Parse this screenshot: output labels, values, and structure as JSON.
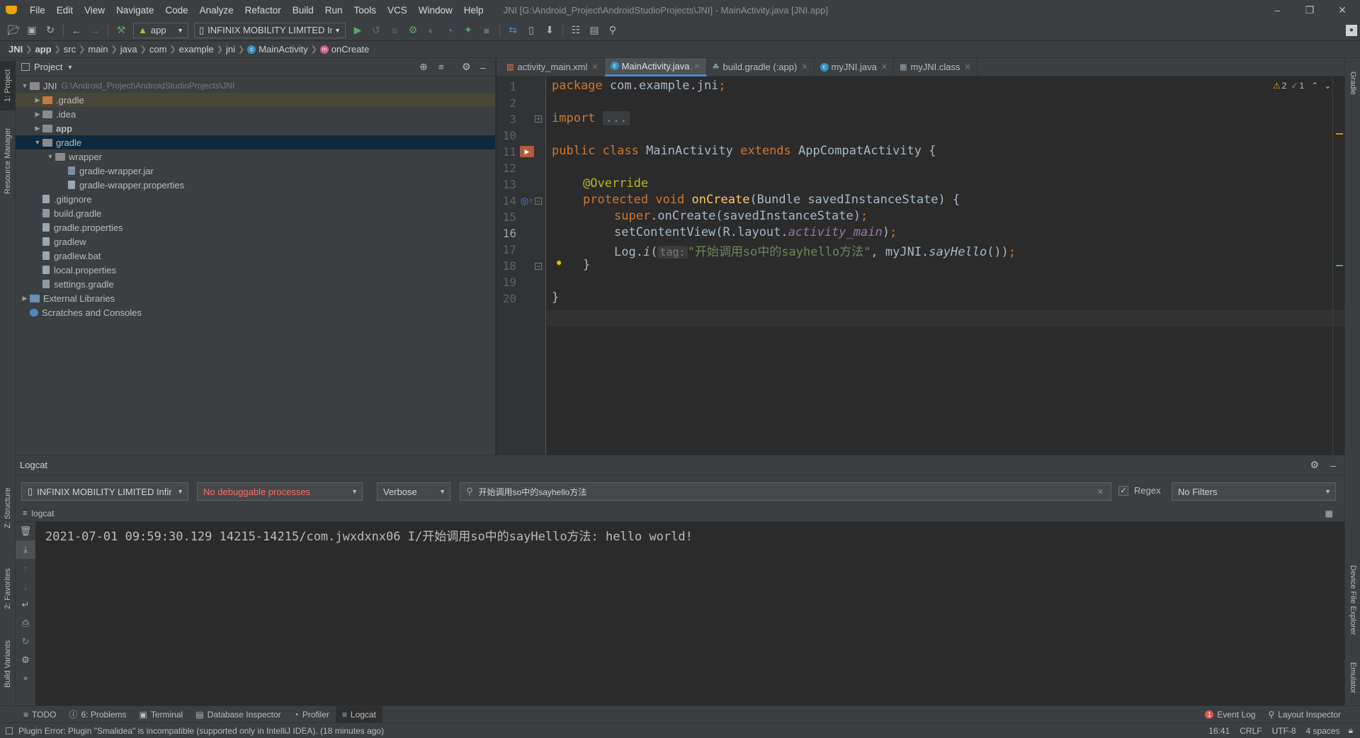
{
  "window": {
    "title": "JNI [G:\\Android_Project\\AndroidStudioProjects\\JNI] - MainActivity.java [JNI.app]"
  },
  "menu": [
    "File",
    "Edit",
    "View",
    "Navigate",
    "Code",
    "Analyze",
    "Refactor",
    "Build",
    "Run",
    "Tools",
    "VCS",
    "Window",
    "Help"
  ],
  "toolbar": {
    "run_config": "app",
    "device": "INFINIX MOBILITY LIMITED Infinix"
  },
  "breadcrumb": [
    "JNI",
    "app",
    "src",
    "main",
    "java",
    "com",
    "example",
    "jni",
    "MainActivity",
    "onCreate"
  ],
  "project_panel": {
    "title": "Project",
    "tree": [
      {
        "label": "JNI",
        "path": "G:\\Android_Project\\AndroidStudioProjects\\JNI",
        "depth": 0,
        "arrow": "down",
        "icon": "folder"
      },
      {
        "label": ".gradle",
        "depth": 1,
        "arrow": "right",
        "icon": "folder-orange",
        "state": "highlight"
      },
      {
        "label": ".idea",
        "depth": 1,
        "arrow": "right",
        "icon": "folder"
      },
      {
        "label": "app",
        "depth": 1,
        "arrow": "right",
        "icon": "folder-module",
        "bold": true
      },
      {
        "label": "gradle",
        "depth": 1,
        "arrow": "down",
        "icon": "folder",
        "state": "selected"
      },
      {
        "label": "wrapper",
        "depth": 2,
        "arrow": "down",
        "icon": "folder"
      },
      {
        "label": "gradle-wrapper.jar",
        "depth": 3,
        "arrow": "",
        "icon": "jar"
      },
      {
        "label": "gradle-wrapper.properties",
        "depth": 3,
        "arrow": "",
        "icon": "properties"
      },
      {
        "label": ".gitignore",
        "depth": 1,
        "arrow": "",
        "icon": "text"
      },
      {
        "label": "build.gradle",
        "depth": 1,
        "arrow": "",
        "icon": "gradle"
      },
      {
        "label": "gradle.properties",
        "depth": 1,
        "arrow": "",
        "icon": "properties"
      },
      {
        "label": "gradlew",
        "depth": 1,
        "arrow": "",
        "icon": "script"
      },
      {
        "label": "gradlew.bat",
        "depth": 1,
        "arrow": "",
        "icon": "script"
      },
      {
        "label": "local.properties",
        "depth": 1,
        "arrow": "",
        "icon": "properties"
      },
      {
        "label": "settings.gradle",
        "depth": 1,
        "arrow": "",
        "icon": "gradle"
      },
      {
        "label": "External Libraries",
        "depth": 0,
        "arrow": "right",
        "icon": "library"
      },
      {
        "label": "Scratches and Consoles",
        "depth": 0,
        "arrow": "",
        "icon": "scratches"
      }
    ]
  },
  "editor": {
    "tabs": [
      {
        "label": "activity_main.xml",
        "icon": "xml"
      },
      {
        "label": "MainActivity.java",
        "icon": "class",
        "active": true
      },
      {
        "label": "build.gradle (:app)",
        "icon": "gradle"
      },
      {
        "label": "myJNI.java",
        "icon": "class"
      },
      {
        "label": "myJNI.class",
        "icon": "class-file"
      }
    ],
    "inspections": {
      "warnings": "2",
      "ok": "1"
    },
    "line_numbers": [
      "1",
      "2",
      "3",
      "10",
      "11",
      "12",
      "13",
      "14",
      "15",
      "16",
      "17",
      "18",
      "19",
      "20"
    ],
    "current_line": "16",
    "code": {
      "l1_kw": "package",
      "l1_rest": " com.example.jni",
      "l1_semi": ";",
      "l3_kw": "import",
      "l3_fold": "...",
      "l11_kw": "public class",
      "l11_name": " MainActivity ",
      "l11_kw2": "extends",
      "l11_rest": " AppCompatActivity {",
      "l13_ann": "@Override",
      "l14_kw": "protected void",
      "l14_fn": "onCreate",
      "l14_rest": "(Bundle savedInstanceState) {",
      "l15_kw": "super",
      "l15_rest": ".onCreate(savedInstanceState)",
      "l15_semi": ";",
      "l16_rest": "setContentView(R.layout.",
      "l16_field": "activity_main",
      "l16_end": ")",
      "l16_semi": ";",
      "l17_pre": "Log.",
      "l17_fn": "i",
      "l17_paren": "(",
      "l17_hint": "tag:",
      "l17_str": "\"开始调用so中的sayhello方法\"",
      "l17_comma": ", myJNI.",
      "l17_fn2": "sayHello",
      "l17_end": "())",
      "l17_semi": ";",
      "l18": "}",
      "l20": "}"
    }
  },
  "logcat": {
    "title": "Logcat",
    "device": "INFINIX MOBILITY LIMITED Infir",
    "process": "No debuggable processes",
    "level": "Verbose",
    "search": "开始调用so中的sayhello方法",
    "regex_label": "Regex",
    "regex_checked": true,
    "filters": "No Filters",
    "sub_tab": "logcat",
    "log_lines": [
      "2021-07-01 09:59:30.129 14215-14215/com.jwxdxnx06 I/开始调用so中的sayHello方法: hello world!"
    ]
  },
  "left_stripe": [
    "1: Project",
    "Resource Manager",
    "Z: Structure",
    "2: Favorites",
    "Build Variants"
  ],
  "right_stripe": [
    "Gradle",
    "Device File Explorer",
    "Emulator"
  ],
  "bottom_tools": {
    "left": [
      "TODO",
      "6: Problems",
      "Terminal",
      "Database Inspector",
      "Profiler",
      "Logcat"
    ],
    "active": "Logcat",
    "right": [
      "Event Log",
      "Layout Inspector"
    ]
  },
  "status": {
    "message": "Plugin Error: Plugin \"Smalidea\" is incompatible (supported only in IntelliJ IDEA). (18 minutes ago)",
    "position": "16:41",
    "line_sep": "CRLF",
    "encoding": "UTF-8",
    "indent": "4 spaces"
  },
  "colors": {
    "background": "#2b2b2b",
    "panel": "#3c3f41",
    "keyword": "#cc7832",
    "string": "#6a8759",
    "annotation": "#bbb529",
    "method": "#ffc66d",
    "selection": "#0d293e",
    "error": "#ff6b68"
  }
}
